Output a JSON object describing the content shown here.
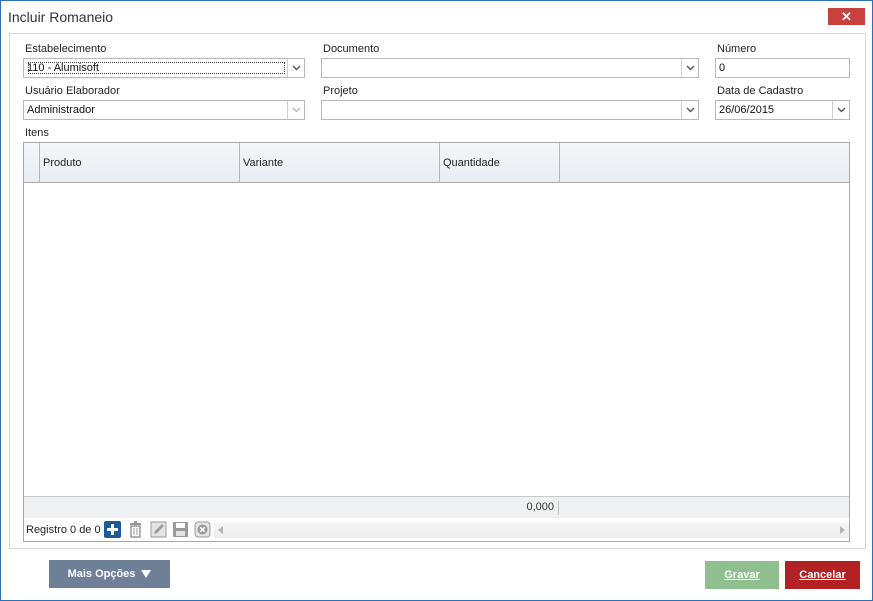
{
  "window": {
    "title": "Incluir Romaneio",
    "close_label": "✕"
  },
  "form": {
    "estabelecimento": {
      "label": "Estabelecimento",
      "value": "110 - Alumisoft"
    },
    "documento": {
      "label": "Documento",
      "value": ""
    },
    "numero": {
      "label": "Número",
      "value": "0"
    },
    "usuario": {
      "label": "Usuário Elaborador",
      "value": "Administrador"
    },
    "projeto": {
      "label": "Projeto",
      "value": ""
    },
    "data_cadastro": {
      "label": "Data de Cadastro",
      "value": "26/06/2015"
    }
  },
  "itens": {
    "label": "Itens",
    "columns": [
      "Produto",
      "Variante",
      "Quantidade"
    ],
    "rows": [],
    "total_quantidade": "0,000",
    "record_text": "Registro 0 de 0",
    "nav_icons": [
      "add-icon",
      "delete-icon",
      "edit-icon",
      "save-icon",
      "cancel-icon"
    ]
  },
  "buttons": {
    "mais_opcoes": "Mais Opções",
    "gravar": "Gravar",
    "cancelar": "Cancelar"
  },
  "colors": {
    "accent": "#2b6fb5",
    "close": "#c9413e",
    "save": "#8fbf8f",
    "cancel": "#b22222",
    "more": "#6d8097"
  }
}
